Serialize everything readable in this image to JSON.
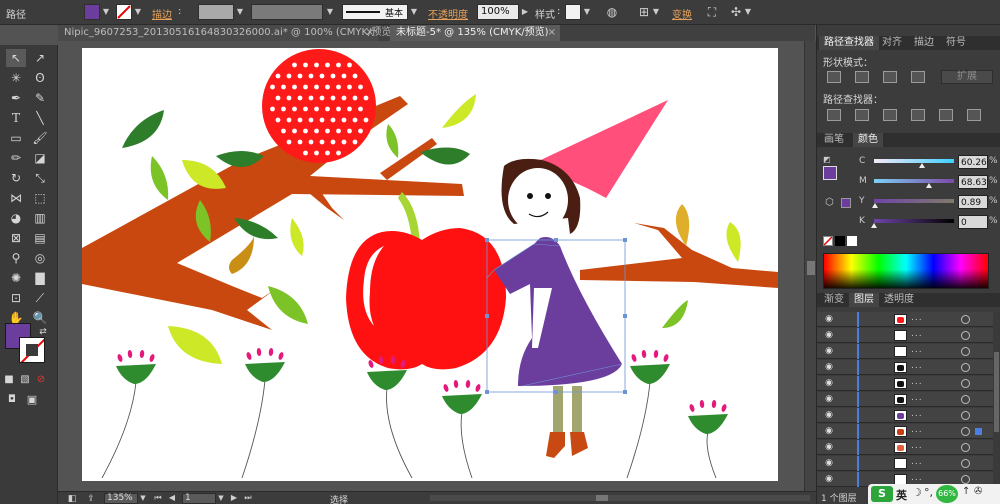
{
  "control": {
    "object_label": "路径",
    "stroke_label": "描边",
    "style_line": "基本",
    "opacity_label": "不透明度",
    "opacity_value": "100%",
    "style_label": "样式",
    "transform_label": "变换",
    "fill_color": "#6b3e9e"
  },
  "tabs": [
    {
      "label": "Nipic_9607253_20130516164830326000.ai* @ 100% (CMYK/预览)"
    },
    {
      "label": "未标题-5* @ 135% (CMYK/预览)"
    }
  ],
  "status": {
    "zoom": "135%",
    "page": "1",
    "tool_name": "选择"
  },
  "pathfinder": {
    "tabs": [
      "路径查找器",
      "对齐",
      "描边",
      "符号"
    ],
    "shape_modes_label": "形状模式：",
    "expand_label": "扩展",
    "pathfinders_label": "路径查找器："
  },
  "color_panel": {
    "tabs": [
      "画笔",
      "颜色"
    ],
    "sliders": [
      {
        "name": "C",
        "value": "60.26",
        "fraction": 0.6
      },
      {
        "name": "M",
        "value": "68.63",
        "fraction": 0.69
      },
      {
        "name": "Y",
        "value": "0.89",
        "fraction": 0.01
      },
      {
        "name": "K",
        "value": "0",
        "fraction": 0.0
      }
    ],
    "swatch_color": "#6b3e9e"
  },
  "layers_panel": {
    "tabs": [
      "渐变",
      "图层",
      "透明度"
    ],
    "footer": "1 个图层",
    "rows": [
      {
        "thumb_color": "#ff1a1a"
      },
      {
        "thumb_color": "#ffffff"
      },
      {
        "thumb_color": "#ffffff"
      },
      {
        "thumb_color": "#111111"
      },
      {
        "thumb_color": "#111111"
      },
      {
        "thumb_color": "#111111"
      },
      {
        "thumb_color": "#6b3e9e"
      },
      {
        "thumb_color": "#c84010"
      },
      {
        "thumb_color": "#e06040"
      },
      {
        "thumb_color": "#ffffff"
      },
      {
        "thumb_color": "#ffffff"
      }
    ]
  },
  "taskbar": {
    "ime_label": "英",
    "badge": "66%"
  }
}
